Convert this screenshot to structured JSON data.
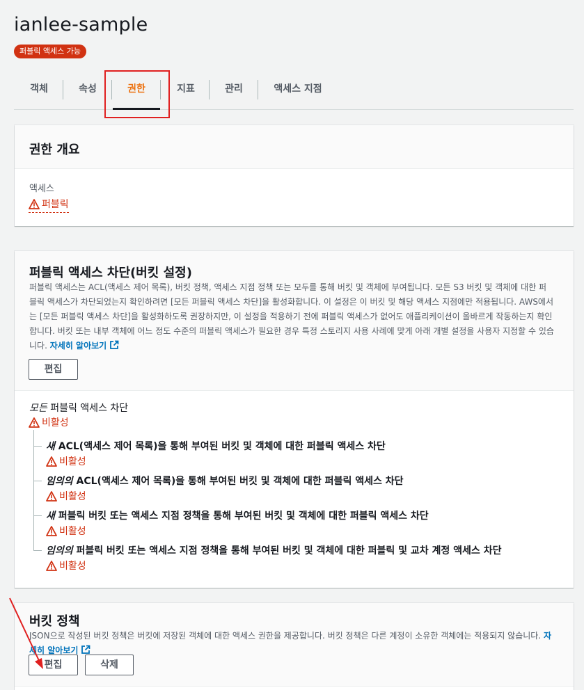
{
  "bucket": {
    "name": "ianlee-sample",
    "access_badge": "퍼블릭 액세스 가능"
  },
  "tabs": [
    {
      "label": "객체",
      "active": false
    },
    {
      "label": "속성",
      "active": false
    },
    {
      "label": "권한",
      "active": true
    },
    {
      "label": "지표",
      "active": false
    },
    {
      "label": "관리",
      "active": false
    },
    {
      "label": "액세스 지점",
      "active": false
    }
  ],
  "permissions_overview": {
    "title": "권한 개요",
    "access_label": "액세스",
    "access_value": "퍼블릭"
  },
  "block_public_access": {
    "title": "퍼블릭 액세스 차단(버킷 설정)",
    "description": "퍼블릭 액세스는 ACL(액세스 제어 목록), 버킷 정책, 액세스 지점 정책 또는 모두를 통해 버킷 및 객체에 부여됩니다. 모든 S3 버킷 및 객체에 대한 퍼블릭 액세스가 차단되었는지 확인하려면 [모든 퍼블릭 액세스 차단]을 활성화합니다. 이 설정은 이 버킷 및 해당 액세스 지점에만 적용됩니다. AWS에서는 [모든 퍼블릭 액세스 차단]을 활성화하도록 권장하지만, 이 설정을 적용하기 전에 퍼블릭 액세스가 없어도 애플리케이션이 올바르게 작동하는지 확인합니다. 버킷 또는 내부 객체에 어느 정도 수준의 퍼블릭 액세스가 필요한 경우 특정 스토리지 사용 사례에 맞게 아래 개별 설정을 사용자 지정할 수 있습니다.",
    "learn_more": "자세히 알아보기",
    "edit_button": "편집",
    "main_rule": {
      "em": "모든",
      "text": " 퍼블릭 액세스 차단",
      "status": "비활성"
    },
    "rules": [
      {
        "em": "새",
        "text": " ACL(액세스 제어 목록)을 통해 부여된 버킷 및 객체에 대한 퍼블릭 액세스 차단",
        "status": "비활성"
      },
      {
        "em": "임의의",
        "text": " ACL(액세스 제어 목록)을 통해 부여된 버킷 및 객체에 대한 퍼블릭 액세스 차단",
        "status": "비활성"
      },
      {
        "em": "새",
        "text": " 퍼블릭 버킷 또는 액세스 지점 정책을 통해 부여된 버킷 및 객체에 대한 퍼블릭 액세스 차단",
        "status": "비활성"
      },
      {
        "em": "임의의",
        "text": " 퍼블릭 버킷 또는 액세스 지점 정책을 통해 부여된 버킷 및 객체에 대한 퍼블릭 및 교차 계정 액세스 차단",
        "status": "비활성"
      }
    ]
  },
  "bucket_policy": {
    "title": "버킷 정책",
    "description": "JSON으로 작성된 버킷 정책은 버킷에 저장된 객체에 대한 액세스 권한을 제공합니다. 버킷 정책은 다른 계정이 소유한 객체에는 적용되지 않습니다.",
    "learn_more": "자세히 알아보기",
    "edit_button": "편집",
    "delete_button": "삭제"
  },
  "colors": {
    "accent": "#ec7211",
    "danger": "#d13212",
    "link": "#0073bb",
    "annotation": "#e02020"
  }
}
